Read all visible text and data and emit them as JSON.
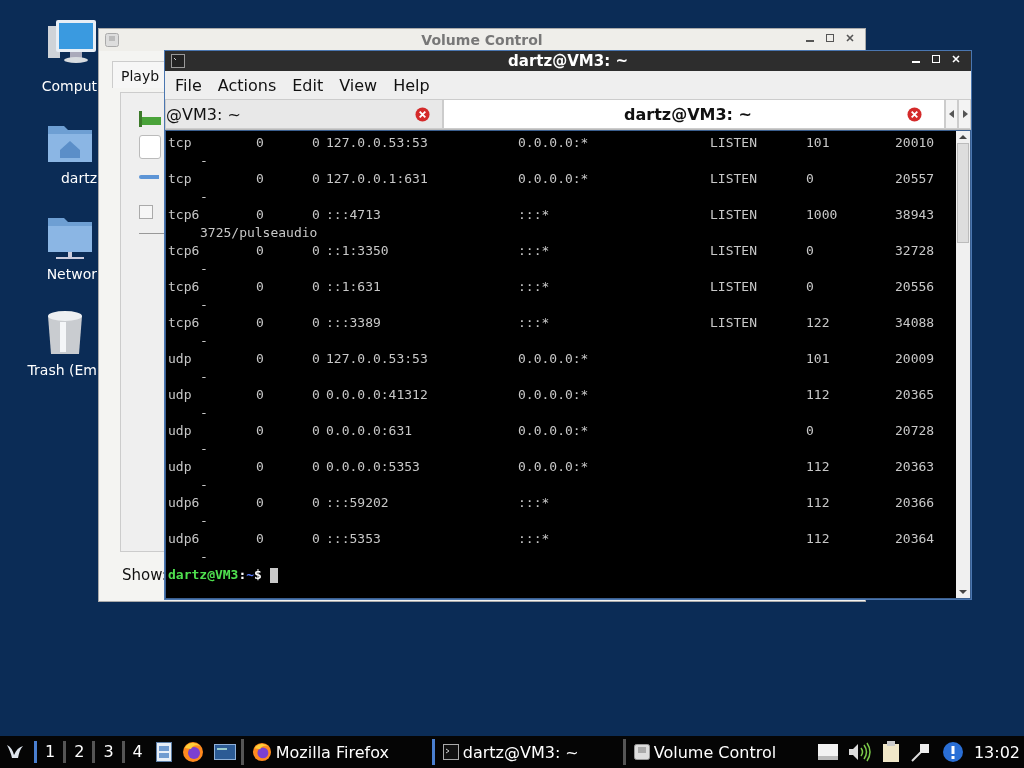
{
  "desktop": {
    "icons": [
      {
        "kind": "computer",
        "label": "Comput"
      },
      {
        "kind": "home",
        "label": "dartz"
      },
      {
        "kind": "network",
        "label": "Networ"
      },
      {
        "kind": "trash",
        "label": "Trash (Em"
      }
    ]
  },
  "volume_window": {
    "title": "Volume Control",
    "tab": "Playb",
    "show_label": "Show:",
    "checkbox": {
      "checked": false
    }
  },
  "terminal_window": {
    "title": "dartz@VM3: ~",
    "menu": [
      "File",
      "Actions",
      "Edit",
      "View",
      "Help"
    ],
    "tabs": [
      {
        "label": "@VM3: ~",
        "selected": false
      },
      {
        "label": "dartz@VM3: ~",
        "selected": true
      }
    ],
    "rows": [
      {
        "column_1": "tcp",
        "column_2": "0",
        "column_3": "0",
        "column_4": "127.0.0.53:53",
        "column_5": "0.0.0.0:*",
        "column_6": "LISTEN",
        "column_7": "101",
        "column_8": "20010",
        "line_2": "-"
      },
      {
        "column_1": "tcp",
        "column_2": "0",
        "column_3": "0",
        "column_4": "127.0.0.1:631",
        "column_5": "0.0.0.0:*",
        "column_6": "LISTEN",
        "column_7": "0",
        "column_8": "20557",
        "line_2": "-"
      },
      {
        "column_1": "tcp6",
        "column_2": "0",
        "column_3": "0",
        "column_4": ":::4713",
        "column_5": ":::*",
        "column_6": "LISTEN",
        "column_7": "1000",
        "column_8": "38943",
        "line_2": "3725/pulseaudio"
      },
      {
        "column_1": "tcp6",
        "column_2": "0",
        "column_3": "0",
        "column_4": "::1:3350",
        "column_5": ":::*",
        "column_6": "LISTEN",
        "column_7": "0",
        "column_8": "32728",
        "line_2": "-"
      },
      {
        "column_1": "tcp6",
        "column_2": "0",
        "column_3": "0",
        "column_4": "::1:631",
        "column_5": ":::*",
        "column_6": "LISTEN",
        "column_7": "0",
        "column_8": "20556",
        "line_2": "-"
      },
      {
        "column_1": "tcp6",
        "column_2": "0",
        "column_3": "0",
        "column_4": ":::3389",
        "column_5": ":::*",
        "column_6": "LISTEN",
        "column_7": "122",
        "column_8": "34088",
        "line_2": "-"
      },
      {
        "column_1": "udp",
        "column_2": "0",
        "column_3": "0",
        "column_4": "127.0.0.53:53",
        "column_5": "0.0.0.0:*",
        "column_7": "101",
        "column_8": "20009",
        "line_2": "-"
      },
      {
        "column_1": "udp",
        "column_2": "0",
        "column_3": "0",
        "column_4": "0.0.0.0:41312",
        "column_5": "0.0.0.0:*",
        "column_7": "112",
        "column_8": "20365",
        "line_2": "-"
      },
      {
        "column_1": "udp",
        "column_2": "0",
        "column_3": "0",
        "column_4": "0.0.0.0:631",
        "column_5": "0.0.0.0:*",
        "column_7": "0",
        "column_8": "20728",
        "line_2": "-"
      },
      {
        "column_1": "udp",
        "column_2": "0",
        "column_3": "0",
        "column_4": "0.0.0.0:5353",
        "column_5": "0.0.0.0:*",
        "column_7": "112",
        "column_8": "20363",
        "line_2": "-"
      },
      {
        "column_1": "udp6",
        "column_2": "0",
        "column_3": "0",
        "column_4": ":::59202",
        "column_5": ":::*",
        "column_7": "112",
        "column_8": "20366",
        "line_2": "-"
      },
      {
        "column_1": "udp6",
        "column_2": "0",
        "column_3": "0",
        "column_4": ":::5353",
        "column_5": ":::*",
        "column_7": "112",
        "column_8": "20364",
        "line_2": "-"
      }
    ],
    "prompt": {
      "user_host": "dartz@VM3",
      "separator": ":",
      "path": "~",
      "symbol": "$"
    }
  },
  "taskbar": {
    "workspaces": [
      {
        "label": "1",
        "selected": true
      },
      {
        "label": "2",
        "selected": false
      },
      {
        "label": "3",
        "selected": false
      },
      {
        "label": "4",
        "selected": false
      }
    ],
    "launchers": [
      {
        "kind": "files"
      },
      {
        "kind": "browser"
      },
      {
        "kind": "screen"
      }
    ],
    "tasks": [
      {
        "kind": "browser",
        "label": "Mozilla Firefox",
        "selected": false
      },
      {
        "kind": "terminal",
        "label": "dartz@VM3: ~",
        "selected": true
      },
      {
        "kind": "volume",
        "label": "Volume Control",
        "selected": false
      }
    ],
    "tray": [
      {
        "kind": "drive"
      },
      {
        "kind": "speaker"
      },
      {
        "kind": "clipboard"
      },
      {
        "kind": "network"
      },
      {
        "kind": "info"
      }
    ],
    "clock": "13:02"
  }
}
